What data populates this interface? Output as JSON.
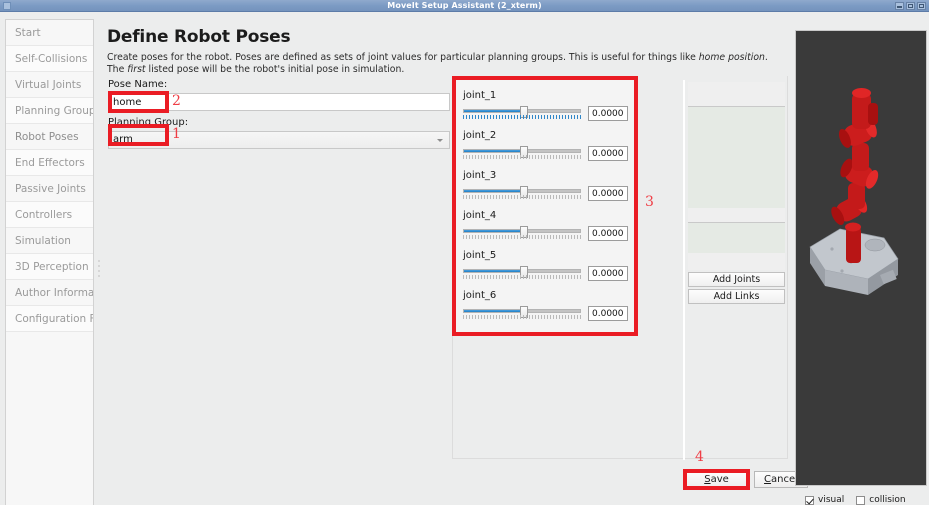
{
  "window": {
    "title": "MoveIt Setup Assistant (2_xterm)",
    "controls": {
      "minimize": "minimize",
      "maximize": "maximize",
      "close": "close"
    }
  },
  "sidebar": {
    "items": [
      {
        "label": "Start"
      },
      {
        "label": "Self-Collisions"
      },
      {
        "label": "Virtual Joints"
      },
      {
        "label": "Planning Groups"
      },
      {
        "label": "Robot Poses"
      },
      {
        "label": "End Effectors"
      },
      {
        "label": "Passive Joints"
      },
      {
        "label": "Controllers"
      },
      {
        "label": "Simulation"
      },
      {
        "label": "3D Perception"
      },
      {
        "label": "Author Information"
      },
      {
        "label": "Configuration Files"
      }
    ]
  },
  "page": {
    "title": "Define Robot Poses",
    "description_part1": "Create poses for the robot. Poses are defined as sets of joint values for particular planning groups. This is useful for things like ",
    "description_em1": "home position",
    "description_part2": ". The ",
    "description_em2": "first",
    "description_part3": " listed pose will be the robot's initial pose in simulation."
  },
  "form": {
    "pose_name_label": "Pose Name:",
    "pose_name_value": "home",
    "planning_group_label": "Planning Group:",
    "planning_group_value": "arm"
  },
  "joints": [
    {
      "name": "joint_1",
      "value": "0.0000",
      "fill_pct": 52,
      "ticks_active": true
    },
    {
      "name": "joint_2",
      "value": "0.0000",
      "fill_pct": 52,
      "ticks_active": false
    },
    {
      "name": "joint_3",
      "value": "0.0000",
      "fill_pct": 52,
      "ticks_active": false
    },
    {
      "name": "joint_4",
      "value": "0.0000",
      "fill_pct": 52,
      "ticks_active": false
    },
    {
      "name": "joint_5",
      "value": "0.0000",
      "fill_pct": 52,
      "ticks_active": false
    },
    {
      "name": "joint_6",
      "value": "0.0000",
      "fill_pct": 52,
      "ticks_active": false
    }
  ],
  "right_panel": {
    "add_joints_label": "Add Joints",
    "add_links_label": "Add Links"
  },
  "footer": {
    "save_label": "Save",
    "save_mnemonic": "S",
    "cancel_label": "Cancel",
    "cancel_mnemonic": "C"
  },
  "viewport": {
    "visual_label": "visual",
    "visual_checked": true,
    "collision_label": "collision",
    "collision_checked": false,
    "background_color": "#3a3a3a",
    "robot_color": "#c41a1a",
    "base_color": "#b8bdc4"
  },
  "annotations": [
    {
      "id": "1",
      "target": "planning-group-combo"
    },
    {
      "id": "2",
      "target": "pose-name-input"
    },
    {
      "id": "3",
      "target": "joints-panel"
    },
    {
      "id": "4",
      "target": "save-button"
    }
  ],
  "colors": {
    "highlight": "#ea1c24",
    "annotation_text": "#ef3e46",
    "slider_fill": "#1f7fc4",
    "titlebar": "#7c9bc4"
  }
}
